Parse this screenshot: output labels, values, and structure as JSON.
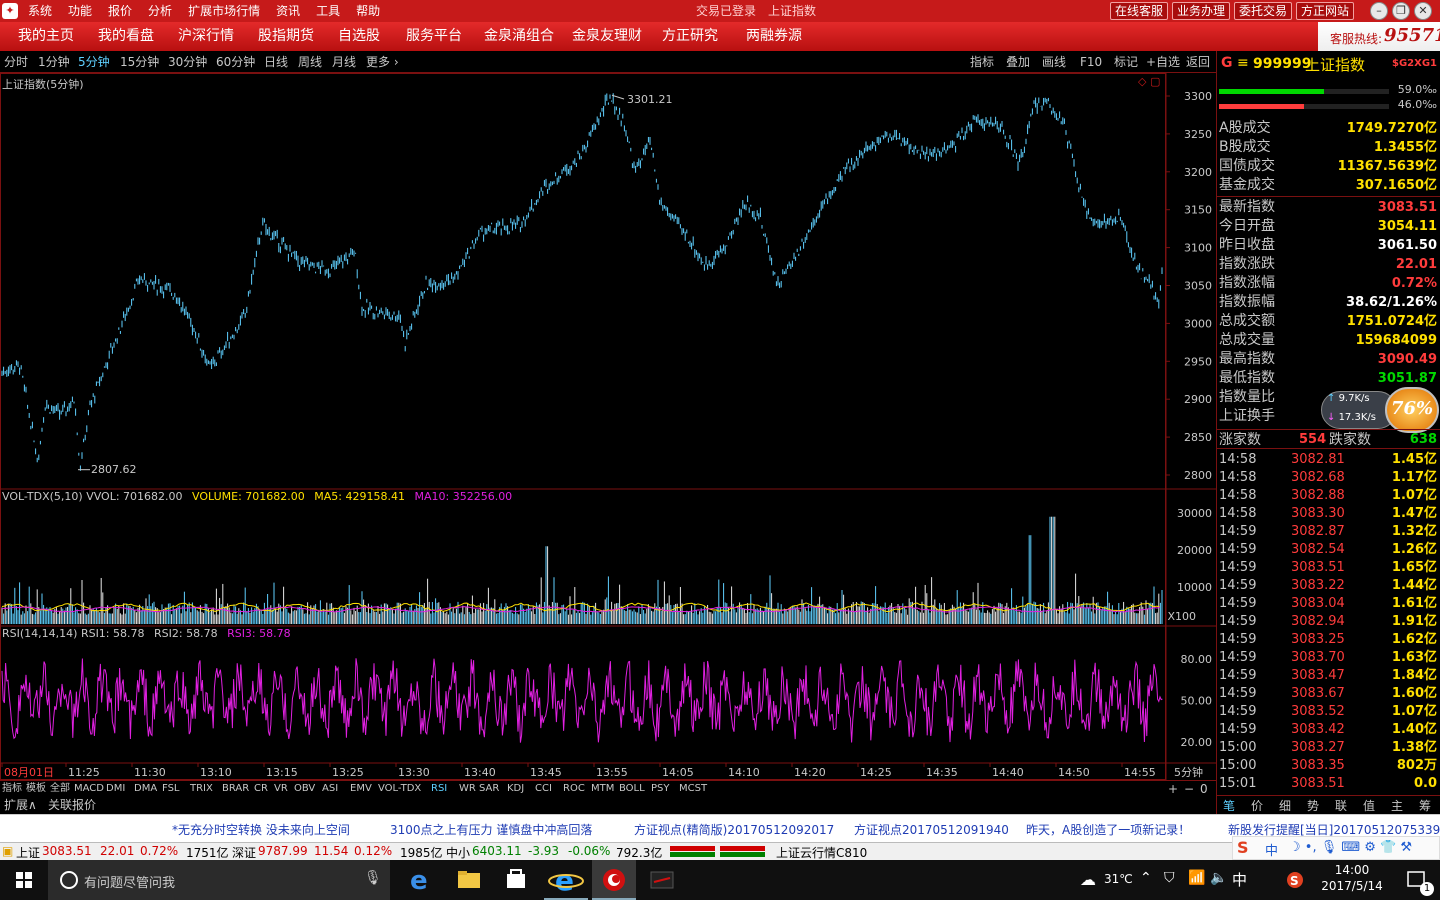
{
  "menubar": {
    "items": [
      "系统",
      "功能",
      "报价",
      "分析",
      "扩展市场行情",
      "资讯",
      "工具",
      "帮助"
    ],
    "login_status": "交易已登录",
    "index_name": "上证指数",
    "buttons": [
      "在线客服",
      "业务办理",
      "委托交易",
      "方正网站"
    ]
  },
  "navbar": {
    "items": [
      "我的主页",
      "我的看盘",
      "沪深行情",
      "股指期货",
      "自选股",
      "服务平台",
      "金泉涌组合",
      "金泉友理财",
      "方正研究",
      "两融券源"
    ],
    "hotline_label": "客服热线:",
    "hotline_number": "95571"
  },
  "periodbar": {
    "periods": [
      "分时",
      "1分钟",
      "5分钟",
      "15分钟",
      "30分钟",
      "60分钟",
      "日线",
      "周线",
      "月线",
      "更多 ›"
    ],
    "selected": "5分钟",
    "tools": [
      "指标",
      "叠加",
      "画线",
      "F10",
      "标记",
      "+自选",
      "返回"
    ]
  },
  "main_chart": {
    "title": "上证指数(5分钟)",
    "y_ticks": [
      "3300",
      "3250",
      "3200",
      "3150",
      "3100",
      "3050",
      "3000",
      "2950",
      "2900",
      "2850",
      "2800"
    ],
    "high_label": "3301.21",
    "low_label": "2807.62"
  },
  "vol_panel": {
    "name": "VOL-TDX(5,10)",
    "vvol": "VVOL: 701682.00",
    "volume": "VOLUME: 701682.00",
    "ma5": "MA5: 429158.41",
    "ma10": "MA10: 352256.00",
    "y_ticks": [
      "30000",
      "20000",
      "10000"
    ],
    "unit": "X100"
  },
  "rsi_panel": {
    "name": "RSI(14,14,14)",
    "rsi1": "RSI1: 58.78",
    "rsi2": "RSI2: 58.78",
    "rsi3": "RSI3: 58.78",
    "y_ticks": [
      "80.00",
      "50.00",
      "20.00"
    ]
  },
  "time_axis": {
    "labels": [
      "08月01日",
      "11:25",
      "11:30",
      "13:10",
      "13:15",
      "13:25",
      "13:30",
      "13:40",
      "13:45",
      "13:55",
      "14:05",
      "14:10",
      "14:20",
      "14:25",
      "14:35",
      "14:40",
      "14:50",
      "14:55"
    ],
    "period": "5分钟"
  },
  "indicator_tabs": [
    "指标",
    "模板",
    "全部",
    "MACD",
    "DMI",
    "DMA",
    "FSL",
    "TRIX",
    "BRAR",
    "CR",
    "VR",
    "OBV",
    "ASI",
    "EMV",
    "VOL-TDX",
    "RSI",
    "WR",
    "SAR",
    "KDJ",
    "CCI",
    "ROC",
    "MTM",
    "BOLL",
    "PSY",
    "MCST"
  ],
  "indicator_selected": "RSI",
  "tab_controls": [
    "+",
    "−",
    "0"
  ],
  "ext_tabs": [
    "扩展∧",
    "关联报价"
  ],
  "sidebar": {
    "badge": "G",
    "code": "999999",
    "name": "上证指数",
    "tag": "$G2XG1",
    "bar_pcts": [
      "59.0‰",
      "46.0‰"
    ],
    "bar_fill": [
      0.62,
      0.5
    ],
    "volumes": [
      {
        "label": "A股成交",
        "value": "1749.7270亿"
      },
      {
        "label": "B股成交",
        "value": "1.3455亿"
      },
      {
        "label": "国债成交",
        "value": "11367.5639亿"
      },
      {
        "label": "基金成交",
        "value": "307.1650亿"
      }
    ],
    "quotes": [
      {
        "label": "最新指数",
        "value": "3083.51",
        "color": "#ff3c3c"
      },
      {
        "label": "今日开盘",
        "value": "3054.11",
        "color": "#ffe000"
      },
      {
        "label": "昨日收盘",
        "value": "3061.50",
        "color": "#ffffff"
      },
      {
        "label": "指数涨跌",
        "value": "22.01",
        "color": "#ff3c3c"
      },
      {
        "label": "指数涨幅",
        "value": "0.72%",
        "color": "#ff3c3c"
      },
      {
        "label": "指数振幅",
        "value": "38.62/1.26%",
        "color": "#ffffff"
      },
      {
        "label": "总成交额",
        "value": "1751.0724亿",
        "color": "#ffe000"
      },
      {
        "label": "总成交量",
        "value": "159684099",
        "color": "#ffe000"
      },
      {
        "label": "最高指数",
        "value": "3090.49",
        "color": "#ff3c3c"
      },
      {
        "label": "最低指数",
        "value": "3051.87",
        "color": "#00d800"
      },
      {
        "label": "指数量比",
        "value": "",
        "color": "#ffffff"
      },
      {
        "label": "上证换手",
        "value": "",
        "color": "#ffffff"
      }
    ],
    "speed_up": "9.7K/s",
    "speed_down": "17.3K/s",
    "speed_pct": "76%",
    "rise_label": "涨家数",
    "rise_value": "554",
    "fall_label": "跌家数",
    "fall_value": "638",
    "ticks": [
      {
        "t": "14:58",
        "p": "3082.81",
        "a": "1.45亿"
      },
      {
        "t": "14:58",
        "p": "3082.68",
        "a": "1.17亿"
      },
      {
        "t": "14:58",
        "p": "3082.88",
        "a": "1.07亿"
      },
      {
        "t": "14:58",
        "p": "3083.30",
        "a": "1.47亿"
      },
      {
        "t": "14:59",
        "p": "3082.87",
        "a": "1.32亿"
      },
      {
        "t": "14:59",
        "p": "3082.54",
        "a": "1.26亿"
      },
      {
        "t": "14:59",
        "p": "3083.51",
        "a": "1.65亿"
      },
      {
        "t": "14:59",
        "p": "3083.22",
        "a": "1.44亿"
      },
      {
        "t": "14:59",
        "p": "3083.04",
        "a": "1.61亿"
      },
      {
        "t": "14:59",
        "p": "3082.94",
        "a": "1.91亿"
      },
      {
        "t": "14:59",
        "p": "3083.25",
        "a": "1.62亿"
      },
      {
        "t": "14:59",
        "p": "3083.70",
        "a": "1.63亿"
      },
      {
        "t": "14:59",
        "p": "3083.47",
        "a": "1.84亿"
      },
      {
        "t": "14:59",
        "p": "3083.67",
        "a": "1.60亿"
      },
      {
        "t": "14:59",
        "p": "3083.52",
        "a": "1.07亿"
      },
      {
        "t": "14:59",
        "p": "3083.42",
        "a": "1.40亿"
      },
      {
        "t": "15:00",
        "p": "3083.27",
        "a": "1.38亿"
      },
      {
        "t": "15:00",
        "p": "3083.35",
        "a": "802万"
      },
      {
        "t": "15:01",
        "p": "3083.51",
        "a": "0.0"
      }
    ],
    "bottom_tabs": [
      "笔",
      "价",
      "细",
      "势",
      "联",
      "值",
      "主",
      "筹"
    ]
  },
  "ticker": [
    "*无充分时空转换 没未来向上空间",
    "3100点之上有压力 谨慎盘中冲高回落",
    "方证视点(精简版)20170512092017",
    "方证视点20170512091940",
    "昨天，A股创造了一项新记录！",
    "新股发行提醒[当日]20170512075339"
  ],
  "statusbar": {
    "sh_label": "上证",
    "sh_price": "3083.51",
    "sh_chg": "22.01",
    "sh_pct": "0.72%",
    "sh_amt": "1751亿",
    "sz_label": "深证",
    "sz_price": "9787.99",
    "sz_chg": "11.54",
    "sz_pct": "0.12%",
    "sz_amt": "1985亿",
    "zx_label": "中小",
    "zx_price": "6403.11",
    "zx_chg": "-3.93",
    "zx_pct": "-0.06%",
    "zx_amt": "792.3亿",
    "cloud": "上证云行情C810"
  },
  "taskbar": {
    "search_placeholder": "有问题尽管问我",
    "temp": "31℃",
    "ime": "中",
    "time": "14:00",
    "date": "2017/5/14",
    "notif": "1"
  },
  "colors": {
    "up": "#ff3c3c",
    "down": "#00d800",
    "candle": "#5fd0ff",
    "accent": "#c61a1a",
    "rsi": "#e020e0",
    "ma5": "#ffe000",
    "ma10": "#e020e0"
  }
}
